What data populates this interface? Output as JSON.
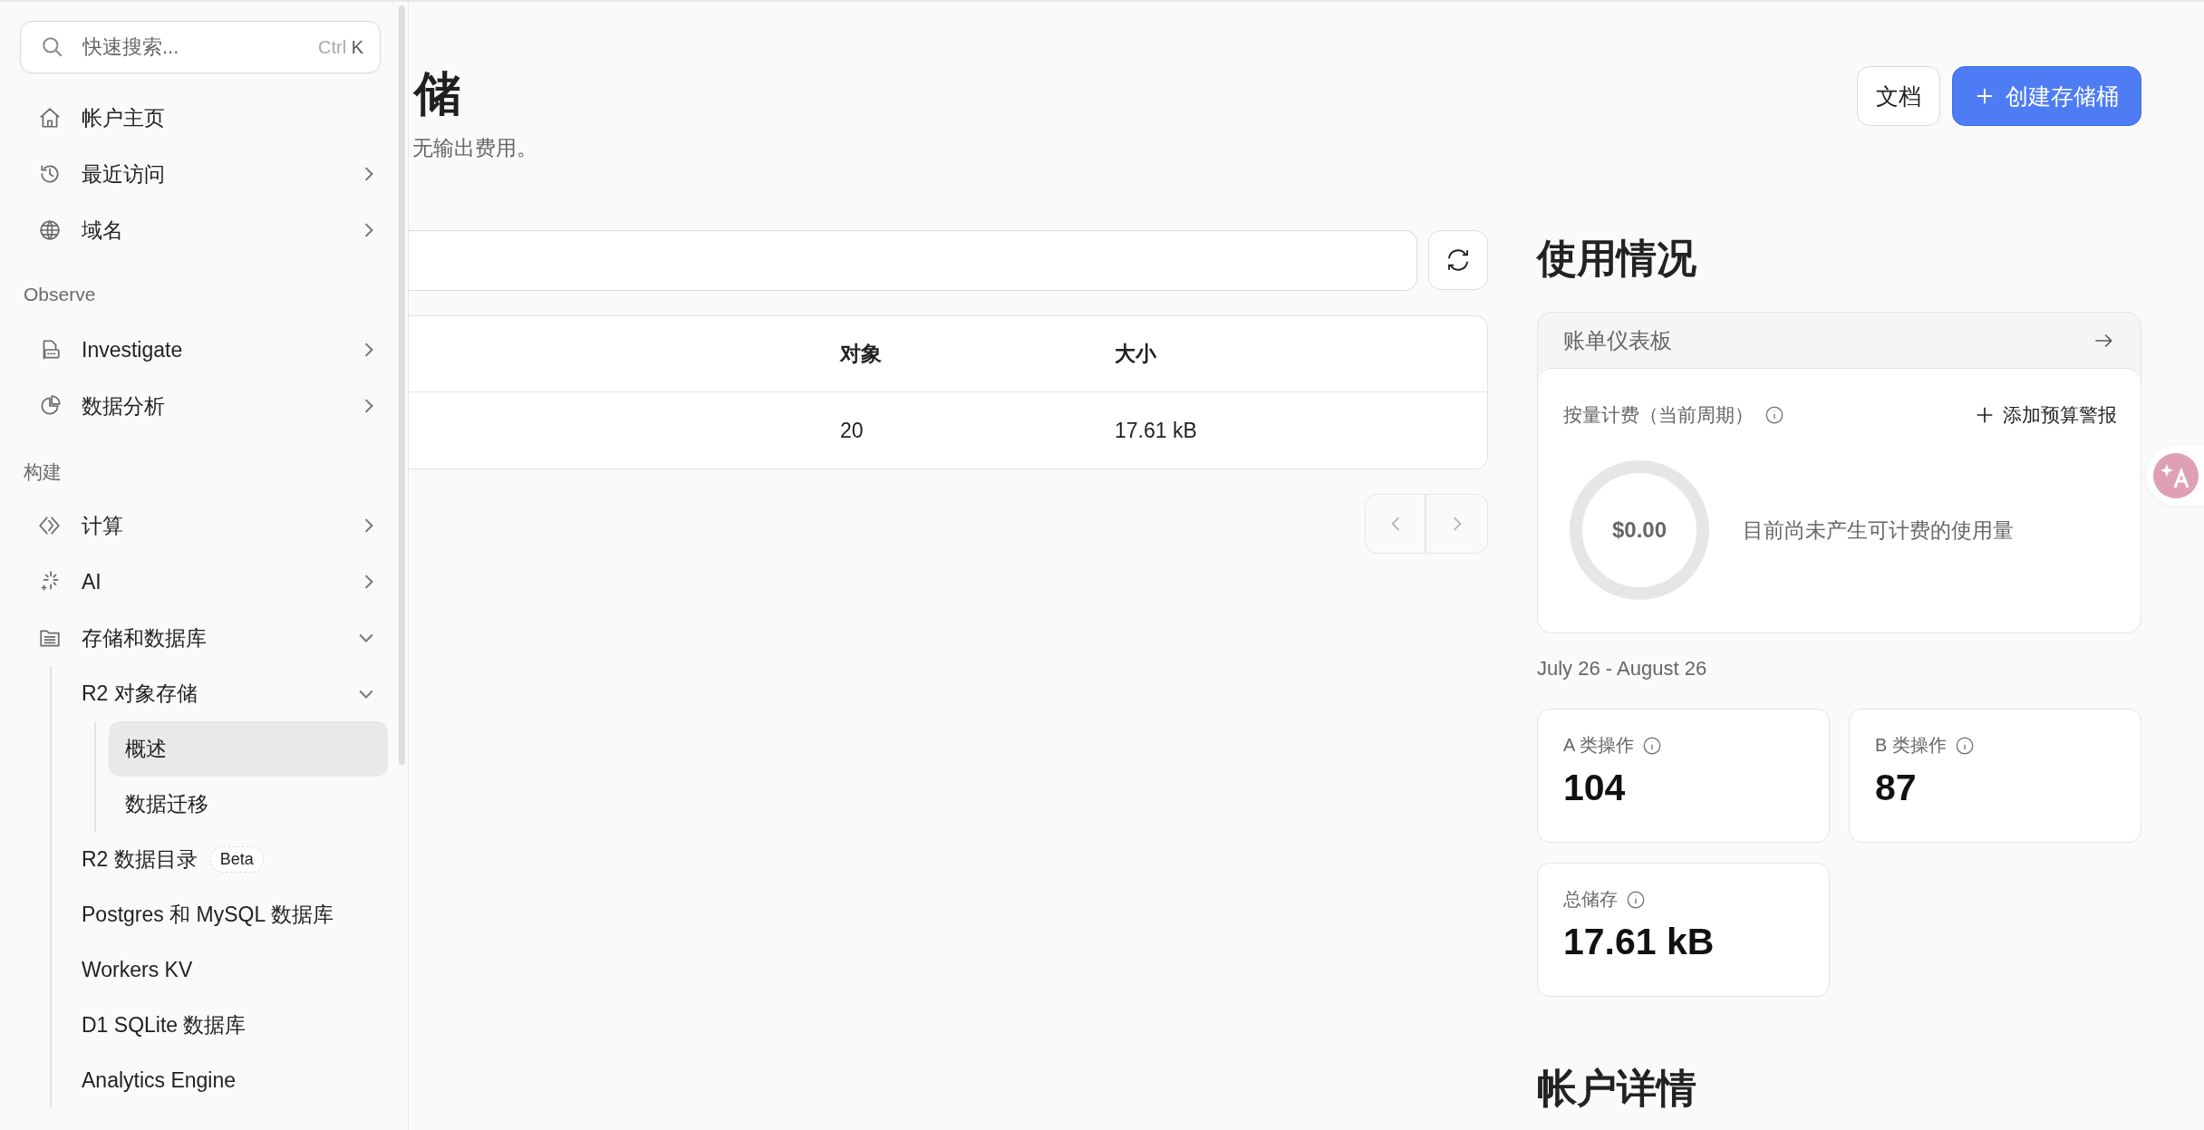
{
  "sidebar": {
    "search": {
      "placeholder": "快速搜索...",
      "shortcut_modifier": "Ctrl",
      "shortcut_key": "K"
    },
    "sections": [
      {
        "items": [
          {
            "label": "帐户主页",
            "kind": "link",
            "selected": false
          },
          {
            "label": "最近访问",
            "kind": "group",
            "expanded": false,
            "selected": false
          },
          {
            "label": "域名",
            "kind": "group",
            "expanded": false,
            "selected": false
          }
        ]
      },
      {
        "title": "Observe",
        "items": [
          {
            "label": "Investigate",
            "kind": "group",
            "expanded": false,
            "selected": false
          },
          {
            "label": "数据分析",
            "kind": "group",
            "expanded": false,
            "selected": false
          }
        ]
      },
      {
        "title": "构建",
        "items": [
          {
            "label": "计算",
            "kind": "group",
            "expanded": false,
            "selected": false
          },
          {
            "label": "AI",
            "kind": "group",
            "expanded": false,
            "selected": false
          },
          {
            "label": "存储和数据库",
            "kind": "group",
            "expanded": true,
            "selected": false,
            "children": [
              {
                "label": "R2 对象存储",
                "kind": "group",
                "expanded": true,
                "selected": false,
                "children": [
                  {
                    "label": "概述",
                    "kind": "link",
                    "selected": true
                  },
                  {
                    "label": "数据迁移",
                    "kind": "link",
                    "selected": false
                  }
                ]
              },
              {
                "label": "R2 数据目录",
                "kind": "link",
                "selected": false,
                "badge": "Beta"
              },
              {
                "label": "Postgres 和 MySQL 数据库",
                "kind": "link",
                "selected": false
              },
              {
                "label": "Workers KV",
                "kind": "link",
                "selected": false
              },
              {
                "label": "D1 SQLite 数据库",
                "kind": "link",
                "selected": false
              },
              {
                "label": "Analytics Engine",
                "kind": "link",
                "selected": false
              }
            ]
          }
        ]
      }
    ]
  },
  "header": {
    "title": "储",
    "subtitle": "无输出费用。",
    "buttons": [
      {
        "label": "文档",
        "kind": "secondary"
      },
      {
        "label": "创建存储桶",
        "kind": "primary"
      }
    ]
  },
  "buckets": {
    "table": {
      "columns": [
        "对象",
        "大小"
      ],
      "rows": [
        [
          "20",
          "17.61 kB"
        ]
      ]
    },
    "pagination": [
      {
        "kind": "prev",
        "disabled": true
      },
      {
        "kind": "next",
        "disabled": true
      }
    ]
  },
  "usage": {
    "title": "使用情况",
    "billing": {
      "link": "账单仪表板",
      "label": "按量计费（当前周期）",
      "action": "添加预算警报",
      "amount": "$0.00",
      "message": "目前尚未产生可计费的使用量"
    },
    "period": "July 26 - August 26",
    "stats": [
      {
        "label": "A 类操作",
        "value": "104"
      },
      {
        "label": "B 类操作",
        "value": "87"
      },
      {
        "label": "总储存",
        "value": "17.61 kB"
      }
    ]
  },
  "account": {
    "title": "帐户详情"
  }
}
